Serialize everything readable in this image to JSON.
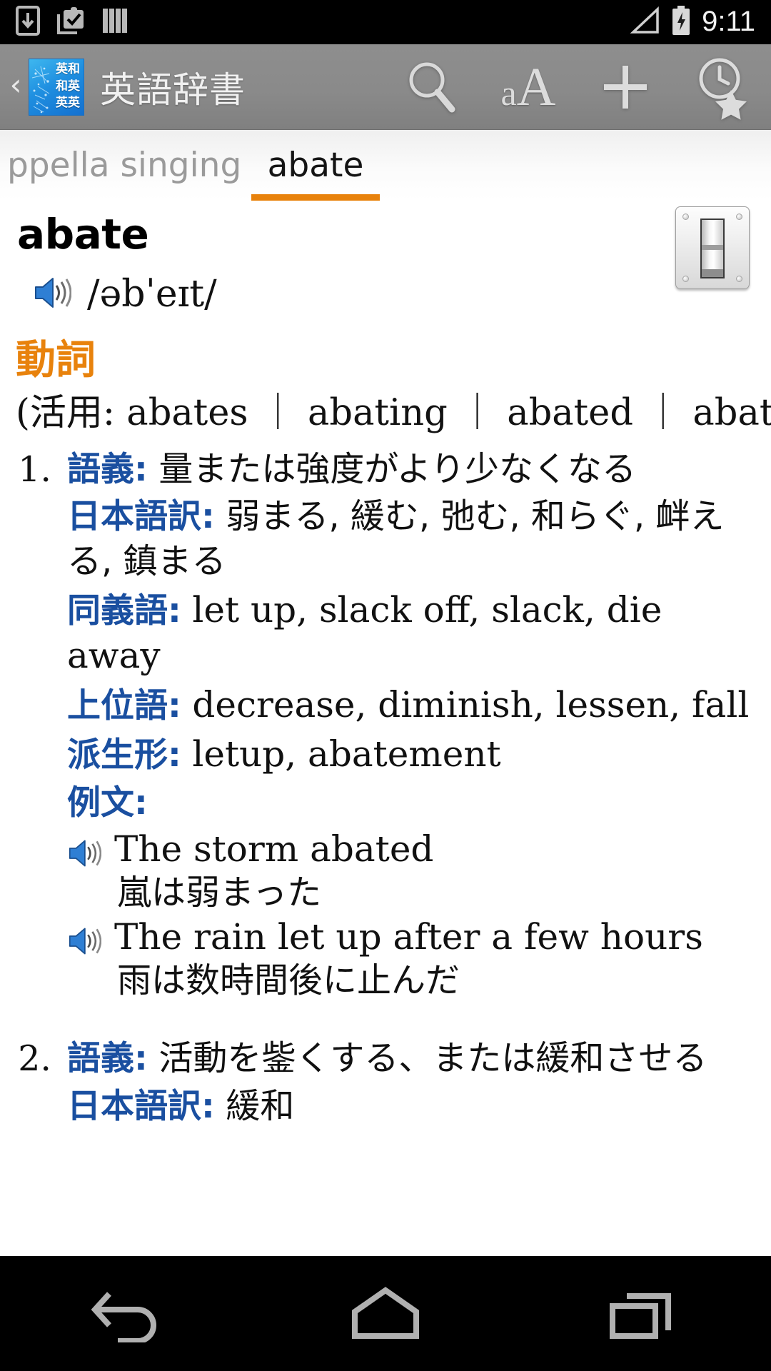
{
  "status_bar": {
    "time": "9:11",
    "icons": [
      "download-icon",
      "clipboard-check-icon",
      "books-icon"
    ],
    "right_icons": [
      "signal-icon",
      "battery-charging-icon"
    ],
    "background": "#000000"
  },
  "action_bar": {
    "up_caret": "‹",
    "app_icon": {
      "name": "english-dictionary-app-icon",
      "lines": [
        "英和",
        "和英",
        "英英"
      ],
      "color": "#1f8fe0"
    },
    "title": "英語辞書",
    "actions": [
      {
        "name": "search-icon",
        "label": "search"
      },
      {
        "name": "font-size-icon",
        "label": "aA",
        "small": "a",
        "big": "A"
      },
      {
        "name": "add-icon",
        "label": "+"
      },
      {
        "name": "history-favorites-icon",
        "label": "history"
      }
    ],
    "background": "#8a8a8a"
  },
  "tabs": {
    "items": [
      {
        "label": "ppella singing",
        "active": false
      },
      {
        "label": "abate",
        "active": true
      }
    ],
    "active_underline_color": "#e8820c"
  },
  "entry": {
    "headword": "abate",
    "speaker_icon": "speaker-icon",
    "ipa": "/əbˈeɪt/",
    "image_name": "light-switch-image",
    "part_of_speech": "動詞",
    "inflection": "(活用: abates ｜ abating ｜ abated ｜ abated)",
    "senses": [
      {
        "num": "1.",
        "gloss_label": "語義:",
        "gloss": "量または強度がより少なくなる",
        "ja_label": "日本語訳:",
        "ja": "弱まる, 緩む, 弛む, 和らぐ, 衅える, 鎮まる",
        "syn_label": "同義語:",
        "syn": "let up, slack off, slack, die away",
        "hyper_label": "上位語:",
        "hyper": "decrease, diminish, lessen, fall",
        "deriv_label": "派生形:",
        "deriv": "letup, abatement",
        "ex_label": "例文:",
        "examples": [
          {
            "en": "The storm abated",
            "ja": "嵐は弱まった"
          },
          {
            "en": "The rain let up after a few hours",
            "ja": "雨は数時間後に止んだ"
          }
        ]
      },
      {
        "num": "2.",
        "gloss_label": "語義:",
        "gloss": "活動を鈭くする、または緩和させる",
        "ja_label": "日本語訳:",
        "ja": "緩和"
      }
    ]
  },
  "nav_bar": {
    "buttons": [
      {
        "name": "back-button",
        "label": "back"
      },
      {
        "name": "home-button",
        "label": "home"
      },
      {
        "name": "recents-button",
        "label": "recents"
      }
    ],
    "background": "#000000"
  }
}
